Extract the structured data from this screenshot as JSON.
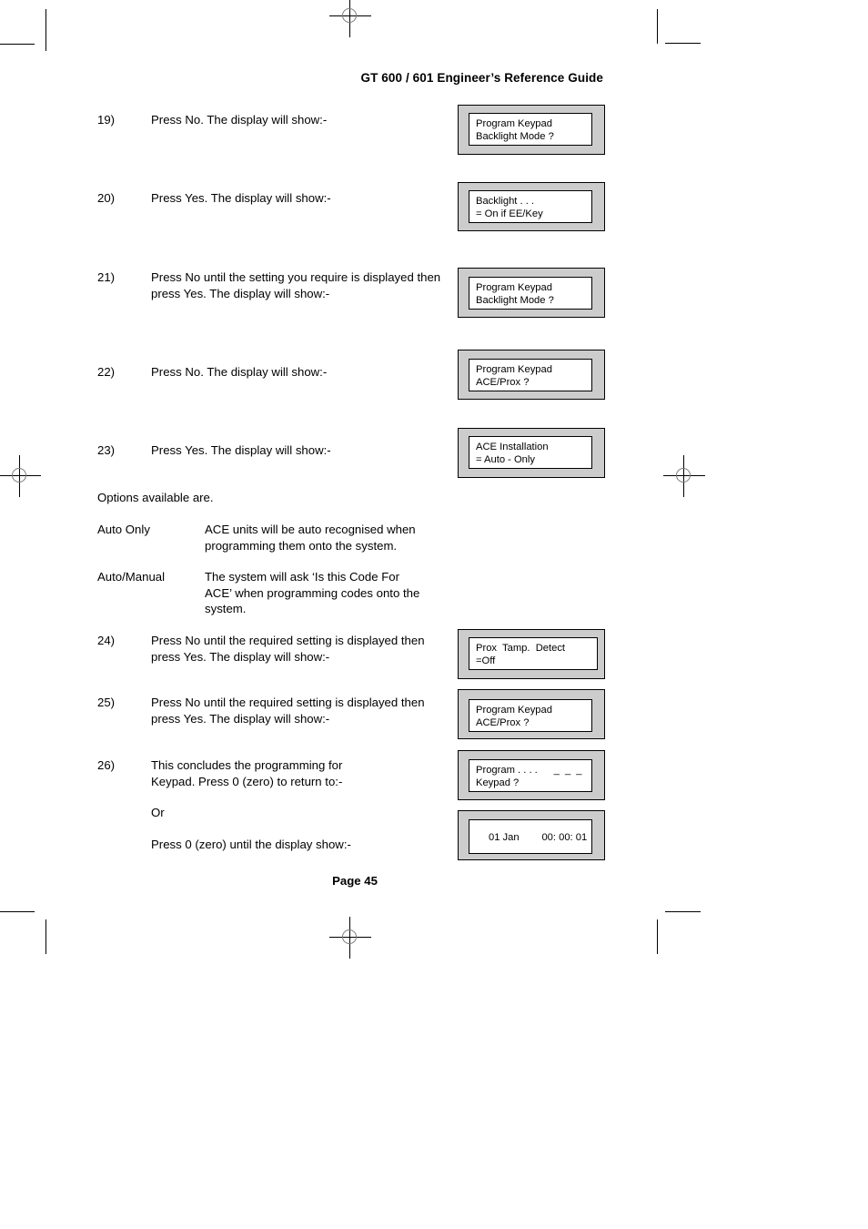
{
  "document": {
    "header_title": "GT 600 / 601 Engineer’s Reference Guide",
    "footer": "Page  45"
  },
  "steps": [
    {
      "number": "19)",
      "text": "Press No. The display will show:-"
    },
    {
      "number": "20)",
      "text": "Press Yes. The display will show:-"
    },
    {
      "number": "21)",
      "text": "Press No until the setting you require is displayed then press Yes. The display will show:-"
    },
    {
      "number": "22)",
      "text": "Press No. The display will show:-"
    },
    {
      "number": "23)",
      "text": "Press Yes. The display will show:-"
    },
    {
      "number": "24)",
      "text": "Press No until the required setting is displayed then press Yes. The display will show:-"
    },
    {
      "number": "25)",
      "text": "Press No until the required setting is displayed then press Yes. The display will show:-"
    },
    {
      "number": "26)",
      "text": "This concludes the programming for Keypad. Press 0 (zero) to return to:-"
    }
  ],
  "options": {
    "intro": "Options available are.",
    "entries": [
      {
        "term": "Auto Only",
        "definition": "ACE units will be auto recognised when programming them onto the system."
      },
      {
        "term": "Auto/Manual",
        "definition": "The system will ask ‘Is this Code For ACE’ when programming codes onto the system."
      }
    ]
  },
  "conclusion": {
    "or": "Or",
    "press_zero": "Press 0 (zero) until the display show:-"
  },
  "displays": [
    {
      "id": "display-19",
      "line1": "Program Keypad",
      "line2": "Backlight Mode ?",
      "right": ""
    },
    {
      "id": "display-20",
      "line1": "Backlight . . .",
      "line2": "= On if EE/Key",
      "right": ""
    },
    {
      "id": "display-21",
      "line1": "Program Keypad",
      "line2": "Backlight Mode ?",
      "right": ""
    },
    {
      "id": "display-22",
      "line1": "Program Keypad",
      "line2": "ACE/Prox ?",
      "right": ""
    },
    {
      "id": "display-23",
      "line1": "ACE Installation",
      "line2": "= Auto - Only",
      "right": ""
    },
    {
      "id": "display-24",
      "line1": "Prox  Tamp.  Detect",
      "line2": "=Off",
      "right": ""
    },
    {
      "id": "display-25",
      "line1": "Program Keypad",
      "line2": "ACE/Prox ?",
      "right": ""
    },
    {
      "id": "display-26",
      "line1": "Program . . . .",
      "line2": "Keypad ?",
      "right": "_ _ _"
    },
    {
      "id": "display-clock",
      "single": "01 Jan        00: 00: 01"
    }
  ],
  "colors": {
    "lcd_bezel": "#cccccc",
    "lcd_screen": "#ffffff",
    "ink": "#000000",
    "regmark_circle": "#7a7a7a"
  }
}
